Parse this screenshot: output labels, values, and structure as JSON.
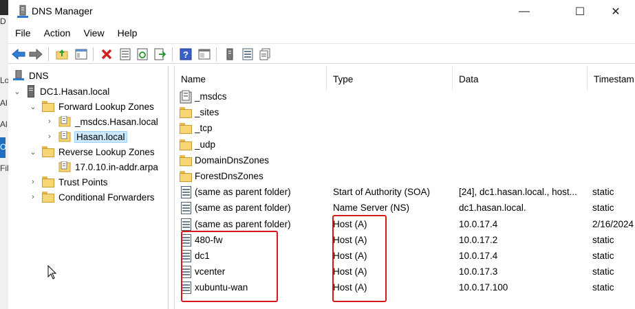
{
  "window": {
    "title": "DNS Manager",
    "minimize": "—",
    "maximize": "☐",
    "close": "✕"
  },
  "desktop_strip": {
    "letters": [
      "D",
      "Lo",
      "Al",
      "Al",
      "O",
      "Fil"
    ]
  },
  "menu": [
    "File",
    "Action",
    "View",
    "Help"
  ],
  "toolbar": {
    "icons": [
      "back-icon",
      "forward-icon",
      "up-folder-icon",
      "show-tree-icon",
      "delete-icon",
      "properties-icon",
      "refresh-icon",
      "export-icon",
      "help-icon",
      "mmc-view-icon",
      "server-icon",
      "record-list-icon",
      "copy-icon"
    ]
  },
  "tree": {
    "root": "DNS",
    "server": "DC1.Hasan.local",
    "forward": "Forward Lookup Zones",
    "msdcs": "_msdcs.Hasan.local",
    "hasan": "Hasan.local",
    "reverse": "Reverse Lookup Zones",
    "reverse_zone": "17.0.10.in-addr.arpa",
    "trust": "Trust Points",
    "conditional": "Conditional Forwarders"
  },
  "list": {
    "columns": {
      "name": "Name",
      "type": "Type",
      "data": "Data",
      "timestamp": "Timestam"
    },
    "rows": [
      {
        "icon": "zone",
        "name": "_msdcs",
        "type": "",
        "data": "",
        "timestamp": ""
      },
      {
        "icon": "folder",
        "name": "_sites",
        "type": "",
        "data": "",
        "timestamp": ""
      },
      {
        "icon": "folder",
        "name": "_tcp",
        "type": "",
        "data": "",
        "timestamp": ""
      },
      {
        "icon": "folder",
        "name": "_udp",
        "type": "",
        "data": "",
        "timestamp": ""
      },
      {
        "icon": "folder",
        "name": "DomainDnsZones",
        "type": "",
        "data": "",
        "timestamp": ""
      },
      {
        "icon": "folder",
        "name": "ForestDnsZones",
        "type": "",
        "data": "",
        "timestamp": ""
      },
      {
        "icon": "record",
        "name": "(same as parent folder)",
        "type": "Start of Authority (SOA)",
        "data": "[24], dc1.hasan.local., host...",
        "timestamp": "static"
      },
      {
        "icon": "record",
        "name": "(same as parent folder)",
        "type": "Name Server (NS)",
        "data": "dc1.hasan.local.",
        "timestamp": "static"
      },
      {
        "icon": "record",
        "name": "(same as parent folder)",
        "type": "Host (A)",
        "data": "10.0.17.4",
        "timestamp": "2/16/2024"
      },
      {
        "icon": "record",
        "name": "480-fw",
        "type": "Host (A)",
        "data": "10.0.17.2",
        "timestamp": "static"
      },
      {
        "icon": "record",
        "name": "dc1",
        "type": "Host (A)",
        "data": "10.0.17.4",
        "timestamp": "static"
      },
      {
        "icon": "record",
        "name": "vcenter",
        "type": "Host (A)",
        "data": "10.0.17.3",
        "timestamp": "static"
      },
      {
        "icon": "record",
        "name": "xubuntu-wan",
        "type": "Host (A)",
        "data": "10.0.17.100",
        "timestamp": "static"
      }
    ]
  },
  "colors": {
    "highlight": "#d11a1a",
    "selection": "#cce8ff",
    "folder": "#f7d574"
  }
}
